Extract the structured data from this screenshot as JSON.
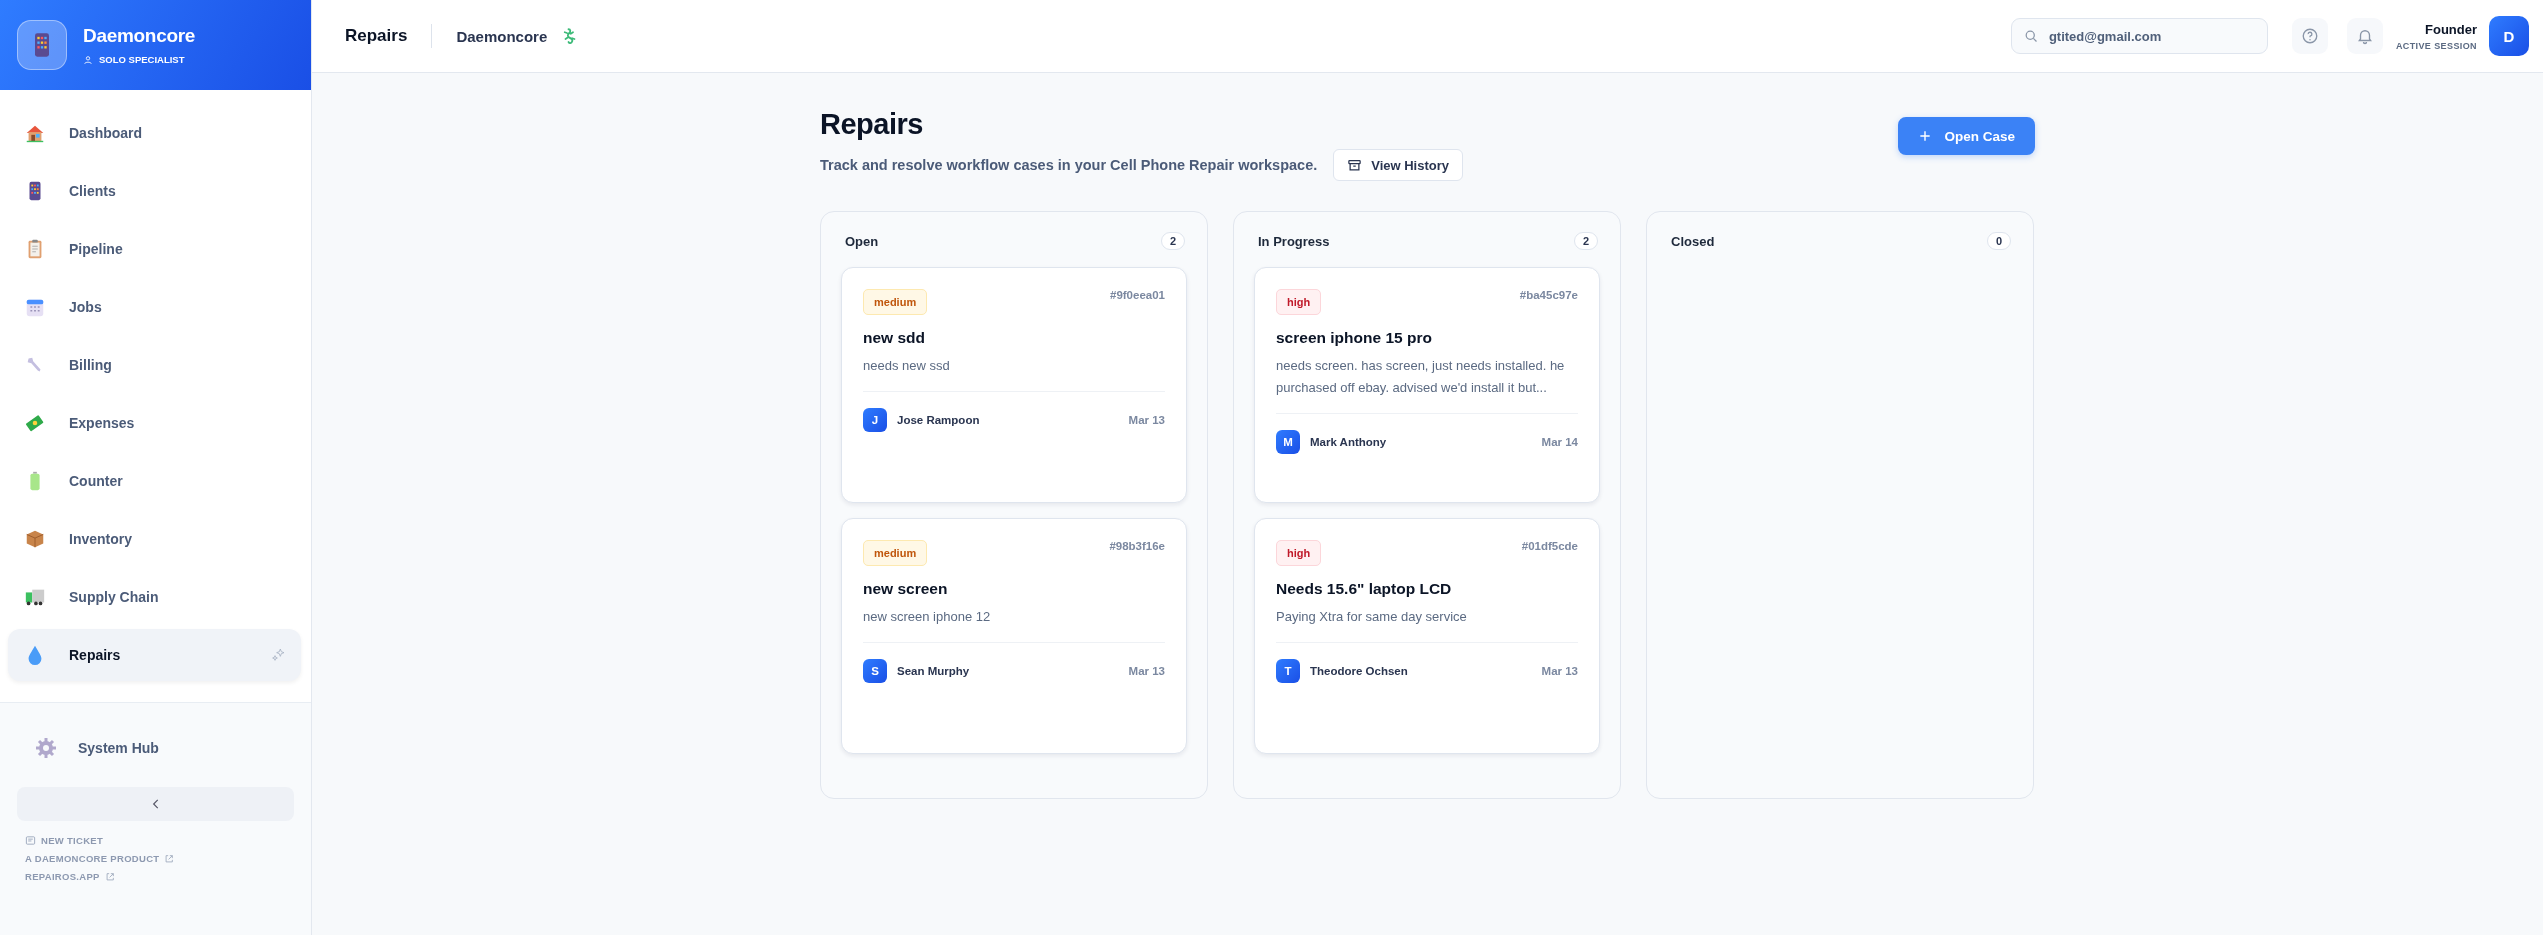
{
  "brand": {
    "name": "Daemoncore",
    "role": "SOLO SPECIALIST"
  },
  "nav": [
    {
      "label": "Dashboard",
      "selected": false
    },
    {
      "label": "Clients",
      "selected": false
    },
    {
      "label": "Pipeline",
      "selected": false
    },
    {
      "label": "Jobs",
      "selected": false
    },
    {
      "label": "Billing",
      "selected": false
    },
    {
      "label": "Expenses",
      "selected": false
    },
    {
      "label": "Counter",
      "selected": false
    },
    {
      "label": "Inventory",
      "selected": false
    },
    {
      "label": "Supply Chain",
      "selected": false
    },
    {
      "label": "Repairs",
      "selected": true
    }
  ],
  "system_hub": {
    "label": "System Hub"
  },
  "footer_links": [
    {
      "label": "NEW TICKET",
      "kind": "ticket"
    },
    {
      "label": "A DAEMONCORE PRODUCT",
      "kind": "external"
    },
    {
      "label": "REPAIROS.APP",
      "kind": "external"
    }
  ],
  "header": {
    "page": "Repairs",
    "workspace": "Daemoncore",
    "search": {
      "value": "gtited@gmail.com"
    },
    "user": {
      "name": "Founder",
      "status": "ACTIVE SESSION",
      "initial": "D"
    }
  },
  "page": {
    "title": "Repairs",
    "subtitle": "Track and resolve workflow cases in your Cell Phone Repair workspace.",
    "history_button": "View History",
    "open_button": "Open Case"
  },
  "columns": [
    {
      "title": "Open",
      "count": "2",
      "cards": [
        {
          "priority": "medium",
          "id": "#9f0eea01",
          "title": "new sdd",
          "description": "needs new ssd",
          "client_initial": "J",
          "client": "Jose Rampoon",
          "date": "Mar 13"
        },
        {
          "priority": "medium",
          "id": "#98b3f16e",
          "title": "new screen",
          "description": "new screen iphone 12",
          "client_initial": "S",
          "client": "Sean Murphy",
          "date": "Mar 13"
        }
      ]
    },
    {
      "title": "In Progress",
      "count": "2",
      "cards": [
        {
          "priority": "high",
          "id": "#ba45c97e",
          "title": "screen iphone 15 pro",
          "description": "needs screen. has screen, just needs installed. he purchased off ebay. advised we'd install it but...",
          "client_initial": "M",
          "client": "Mark Anthony",
          "date": "Mar 14"
        },
        {
          "priority": "high",
          "id": "#01df5cde",
          "title": "Needs 15.6\" laptop LCD",
          "description": "Paying Xtra for same day service",
          "client_initial": "T",
          "client": "Theodore Ochsen",
          "date": "Mar 13"
        }
      ]
    },
    {
      "title": "Closed",
      "count": "0"
    }
  ]
}
